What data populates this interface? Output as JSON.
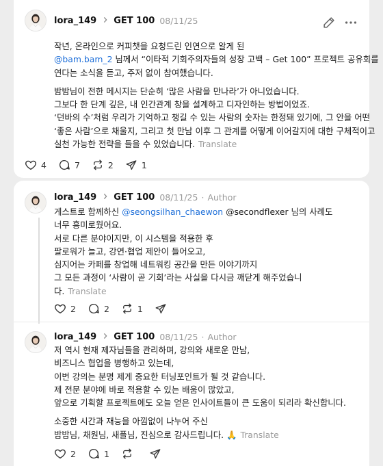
{
  "posts": [
    {
      "username": "lora_149",
      "topic": "GET 100",
      "date": "08/11/25",
      "paragraphs": [
        [
          [
            {
              "t": "작년, 온라인으로 커피챗을 요청드린 인연으로 알게 된"
            }
          ],
          [
            {
              "t": "@bam.bam_2",
              "m": true
            },
            {
              "t": " 님께서 “이타적 기회주의자들의 성장 고백 – Get 100” 프로젝트 공유회를"
            }
          ],
          [
            {
              "t": "연다는 소식을 듣고, 주저 없이 참여했습니다."
            }
          ]
        ],
        [
          [
            {
              "t": "밤밤님이 전한 메시지는 단순히 ‘많은 사람을 만나라’가 아니었습니다."
            }
          ],
          [
            {
              "t": "그보다 한 단계 깊은, 내 인간관계 창을 설계하고 디자인하는 방법이었죠."
            }
          ],
          [
            {
              "t": "‘던바의 수’처럼 우리가 기억하고 챙길 수 있는 사람의 숫자는 한정돼 있기에, 그 안을 어떤"
            }
          ],
          [
            {
              "t": "‘좋은 사람’으로 채울지, 그리고 첫 만남 이후 그 관계를 어떻게 이어갈지에 대한 구체적이고"
            }
          ],
          [
            {
              "t": "실천 가능한 전략을 들을 수 있었습니다."
            }
          ]
        ]
      ],
      "translate": "Translate",
      "counts": {
        "likes": "4",
        "replies": "7",
        "reposts": "2",
        "shares": "1"
      }
    },
    {
      "username": "lora_149",
      "topic": "GET 100",
      "date": "08/11/25",
      "dot": "·",
      "author_label": "Author",
      "paragraphs": [
        [
          [
            {
              "t": "게스트로 함께하신 "
            },
            {
              "t": "@seongsilhan_chaewon",
              "m": true
            },
            {
              "t": " @secondflexer 님의 사례도"
            }
          ],
          [
            {
              "t": "너무 흥미로웠어요."
            }
          ],
          [
            {
              "t": "서로 다른 분야이지만, 이 시스템을 적용한 후"
            }
          ],
          [
            {
              "t": "팔로워가 늘고, 강연·협업 제안이 들어오고,"
            }
          ],
          [
            {
              "t": "심지어는 카페를 창업해 네트워킹 공간을 만든 이야기까지"
            }
          ],
          [
            {
              "t": "그 모든 과정이 ‘사람이 곧 기회’라는 사실을 다시금 깨닫게 해주었습니"
            }
          ],
          [
            {
              "t": "다."
            }
          ]
        ]
      ],
      "translate": "Translate",
      "counts": {
        "likes": "2",
        "replies": "2",
        "reposts": "1",
        "shares": ""
      }
    },
    {
      "username": "lora_149",
      "topic": "GET 100",
      "date": "08/11/25",
      "dot": "·",
      "author_label": "Author",
      "paragraphs": [
        [
          [
            {
              "t": "저 역시 현재 제자님들을 관리하며, 강의와 새로운 만남,"
            }
          ],
          [
            {
              "t": "비즈니스 협업을 병행하고 있는데,"
            }
          ],
          [
            {
              "t": "이번 강의는 분명 제게 중요한 터닝포인트가 될 것 같습니다."
            }
          ],
          [
            {
              "t": "제 전문 분야에 바로 적용할 수 있는 배움이 많았고,"
            }
          ],
          [
            {
              "t": "앞으로 기획할 프로젝트에도 오늘 얻은 인사이트들이 큰 도움이 되리라 확신합니다."
            }
          ]
        ],
        [
          [
            {
              "t": "소중한 시간과 재능을 아낌없이 나누어 주신"
            }
          ],
          [
            {
              "t": "밤밤님, 채원님, 새플님, 진심으로 감사드립니다. 🙏"
            }
          ]
        ]
      ],
      "translate": "Translate",
      "counts": {
        "likes": "2",
        "replies": "1",
        "reposts": "",
        "shares": ""
      }
    }
  ],
  "icons": {
    "edit": "pencil-icon",
    "more": "more-options-icon",
    "like": "heart-icon",
    "reply": "comment-icon",
    "repost": "repost-icon",
    "share": "send-icon",
    "chevron": "chevron-right-icon"
  },
  "colors": {
    "background": "#ededed",
    "card": "#ffffff",
    "mention": "#1e6fd9",
    "muted": "#9a9a9a"
  }
}
